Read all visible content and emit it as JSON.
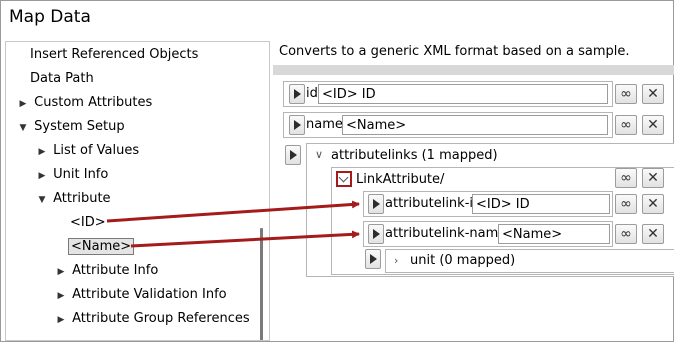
{
  "window": {
    "title": "Map Data"
  },
  "tree": {
    "items": [
      {
        "label": "Insert Referenced Objects",
        "expander": ""
      },
      {
        "label": "Data Path",
        "expander": ""
      },
      {
        "label": "Custom Attributes",
        "expander": "collapsed"
      },
      {
        "label": "System Setup",
        "expander": "expanded"
      },
      {
        "label": "List of Values",
        "expander": "collapsed"
      },
      {
        "label": "Unit Info",
        "expander": "collapsed"
      },
      {
        "label": "Attribute",
        "expander": "expanded"
      },
      {
        "label": "<ID>",
        "expander": ""
      },
      {
        "label": "<Name>",
        "expander": "",
        "selected": true
      },
      {
        "label": "Attribute Info",
        "expander": "collapsed"
      },
      {
        "label": "Attribute Validation Info",
        "expander": "collapsed"
      },
      {
        "label": "Attribute Group References",
        "expander": "collapsed"
      }
    ]
  },
  "mapping": {
    "description": "Converts to a generic XML format based on a sample.",
    "fields": [
      {
        "name": "id",
        "value": "<ID> ID"
      },
      {
        "name": "name",
        "value": "<Name>"
      }
    ],
    "group": {
      "label": "attributelinks (1 mapped)",
      "child": {
        "label": "LinkAttribute/",
        "fields": [
          {
            "name": "attributelink-id",
            "value": "<ID> ID"
          },
          {
            "name": "attributelink-name",
            "value": "<Name>"
          }
        ],
        "subgroup": {
          "label": "unit (0 mapped)"
        }
      }
    }
  },
  "colors": {
    "arrow": "#a41b1b",
    "highlight": "#a41b1b"
  },
  "icons": {
    "tree_expand": "triangle-right-icon",
    "tree_collapse": "triangle-down-icon",
    "link": "link-chain-icon",
    "remove": "close-x-icon"
  }
}
